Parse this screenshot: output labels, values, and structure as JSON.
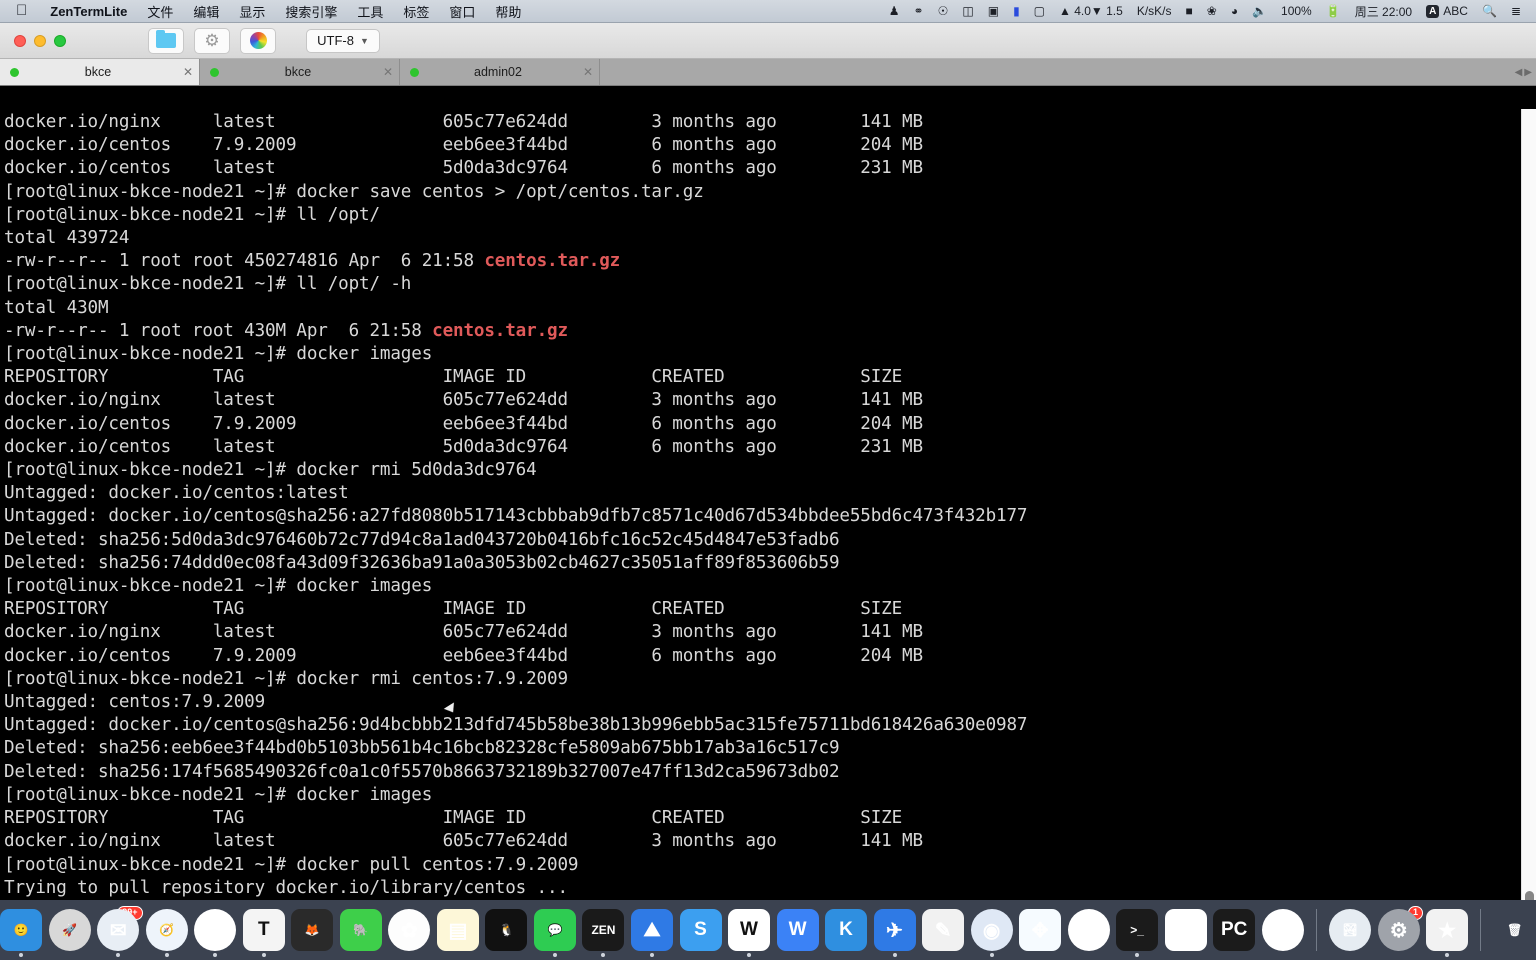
{
  "menubar": {
    "apple_icon": "apple-logo-icon",
    "app_name": "ZenTermLite",
    "items": [
      "文件",
      "编辑",
      "显示",
      "搜索引擎",
      "工具",
      "标签",
      "窗口",
      "帮助"
    ],
    "status": {
      "net_up": "▲ 4.0",
      "net_up_unit": "K/s",
      "net_down": "▼ 1.5",
      "net_down_unit": "K/s",
      "battery_percent": "100%",
      "clock": "周三 22:00",
      "input_badge": "A",
      "input_method": "ABC",
      "icons": [
        "bell-icon",
        "wechat-icon",
        "app-icon",
        "columns-icon",
        "screen-record-icon",
        "battery-bar-icon",
        "phone-icon",
        "network-speed-icon",
        "display-icon",
        "bluetooth-icon",
        "wifi-icon",
        "volume-icon",
        "battery-charging-icon",
        "search-icon",
        "control-center-icon"
      ]
    }
  },
  "titlebar": {
    "traffic_lights": [
      "close",
      "minimize",
      "zoom"
    ],
    "toolbar_buttons": [
      {
        "name": "folder-icon"
      },
      {
        "name": "gear-icon"
      },
      {
        "name": "color-wheel-icon"
      }
    ],
    "encoding": {
      "value": "UTF-8",
      "chevron": "chevron-down-icon"
    }
  },
  "tabs": [
    {
      "label": "bkce",
      "active": true,
      "status": "connected"
    },
    {
      "label": "bkce",
      "active": false,
      "status": "connected"
    },
    {
      "label": "admin02",
      "active": false,
      "status": "connected"
    }
  ],
  "terminal": {
    "prompt": "[root@linux-bkce-node21 ~]#",
    "lines": [
      {
        "t": "docker.io/nginx     latest                605c77e624dd        3 months ago        141 MB"
      },
      {
        "t": "docker.io/centos    7.9.2009              eeb6ee3f44bd        6 months ago        204 MB"
      },
      {
        "t": "docker.io/centos    latest                5d0da3dc9764        6 months ago        231 MB"
      },
      {
        "t": "[root@linux-bkce-node21 ~]# docker save centos > /opt/centos.tar.gz"
      },
      {
        "t": "[root@linux-bkce-node21 ~]# ll /opt/"
      },
      {
        "t": "total 439724"
      },
      {
        "t": "-rw-r--r-- 1 root root 450274816 Apr  6 21:58 ",
        "red": "centos.tar.gz"
      },
      {
        "t": "[root@linux-bkce-node21 ~]# ll /opt/ -h"
      },
      {
        "t": "total 430M"
      },
      {
        "t": "-rw-r--r-- 1 root root 430M Apr  6 21:58 ",
        "red": "centos.tar.gz"
      },
      {
        "t": "[root@linux-bkce-node21 ~]# docker images"
      },
      {
        "t": "REPOSITORY          TAG                   IMAGE ID            CREATED             SIZE"
      },
      {
        "t": "docker.io/nginx     latest                605c77e624dd        3 months ago        141 MB"
      },
      {
        "t": "docker.io/centos    7.9.2009              eeb6ee3f44bd        6 months ago        204 MB"
      },
      {
        "t": "docker.io/centos    latest                5d0da3dc9764        6 months ago        231 MB"
      },
      {
        "t": "[root@linux-bkce-node21 ~]# docker rmi 5d0da3dc9764"
      },
      {
        "t": "Untagged: docker.io/centos:latest"
      },
      {
        "t": "Untagged: docker.io/centos@sha256:a27fd8080b517143cbbbab9dfb7c8571c40d67d534bbdee55bd6c473f432b177"
      },
      {
        "t": "Deleted: sha256:5d0da3dc976460b72c77d94c8a1ad043720b0416bfc16c52c45d4847e53fadb6"
      },
      {
        "t": "Deleted: sha256:74ddd0ec08fa43d09f32636ba91a0a3053b02cb4627c35051aff89f853606b59"
      },
      {
        "t": "[root@linux-bkce-node21 ~]# docker images"
      },
      {
        "t": "REPOSITORY          TAG                   IMAGE ID            CREATED             SIZE"
      },
      {
        "t": "docker.io/nginx     latest                605c77e624dd        3 months ago        141 MB"
      },
      {
        "t": "docker.io/centos    7.9.2009              eeb6ee3f44bd        6 months ago        204 MB"
      },
      {
        "t": "[root@linux-bkce-node21 ~]# docker rmi centos:7.9.2009"
      },
      {
        "t": "Untagged: centos:7.9.2009"
      },
      {
        "t": "Untagged: docker.io/centos@sha256:9d4bcbbb213dfd745b58be38b13b996ebb5ac315fe75711bd618426a630e0987"
      },
      {
        "t": "Deleted: sha256:eeb6ee3f44bd0b5103bb561b4c16bcb82328cfe5809ab675bb17ab3a16c517c9"
      },
      {
        "t": "Deleted: sha256:174f5685490326fc0a1c0f5570b8663732189b327007e47ff13d2ca59673db02"
      },
      {
        "t": "[root@linux-bkce-node21 ~]# docker images"
      },
      {
        "t": "REPOSITORY          TAG                   IMAGE ID            CREATED             SIZE"
      },
      {
        "t": "docker.io/nginx     latest                605c77e624dd        3 months ago        141 MB"
      },
      {
        "t": "[root@linux-bkce-node21 ~]# docker pull centos:7.9.2009"
      },
      {
        "t": "Trying to pull repository docker.io/library/centos ..."
      }
    ],
    "cursor_visible": true,
    "colors": {
      "background": "#000000",
      "foreground": "#d8d8d8",
      "red": "#e05a5a",
      "cursor": "#2ee02e"
    }
  },
  "dock": {
    "items": [
      {
        "name": "finder-icon",
        "glyph": "🙂",
        "bg": "#2f8fe0",
        "running": true
      },
      {
        "name": "launchpad-icon",
        "glyph": "🚀",
        "bg": "#d8d8d8",
        "running": false
      },
      {
        "name": "foxmail-icon",
        "glyph": "✉",
        "bg": "#e8eef5",
        "running": true,
        "badge": "99+"
      },
      {
        "name": "safari-icon",
        "glyph": "🧭",
        "bg": "#eef4fb",
        "running": true
      },
      {
        "name": "chrome-icon",
        "glyph": "◎",
        "bg": "#ffffff",
        "running": true
      },
      {
        "name": "typora-icon",
        "glyph": "T",
        "bg": "#f4f4f4",
        "running": true
      },
      {
        "name": "firefox-icon",
        "glyph": "🦊",
        "bg": "#2a2a2a",
        "running": false
      },
      {
        "name": "evernote-icon",
        "glyph": "🐘",
        "bg": "#3ecf4a",
        "running": false
      },
      {
        "name": "photos-icon",
        "glyph": "✿",
        "bg": "#fdfdfd",
        "running": false
      },
      {
        "name": "notes-icon",
        "glyph": "▤",
        "bg": "#fdf7d8",
        "running": false
      },
      {
        "name": "qq-icon",
        "glyph": "🐧",
        "bg": "#111111",
        "running": false
      },
      {
        "name": "wechat-icon",
        "glyph": "💬",
        "bg": "#2ecc52",
        "running": true
      },
      {
        "name": "zentermlite-icon",
        "glyph": "ZEN",
        "bg": "#1a1a1a",
        "running": true
      },
      {
        "name": "mountain-app-icon",
        "glyph": "⛰",
        "bg": "#2f7ae5",
        "running": true
      },
      {
        "name": "shanchuan-icon",
        "glyph": "S",
        "bg": "#3c9ff0",
        "running": false
      },
      {
        "name": "wps-icon",
        "glyph": "W",
        "bg": "#ffffff",
        "running": true
      },
      {
        "name": "wiz-icon",
        "glyph": "W",
        "bg": "#3b82f6",
        "running": false
      },
      {
        "name": "keka-icon",
        "glyph": "K",
        "bg": "#2f8fe0",
        "running": false
      },
      {
        "name": "tim-icon",
        "glyph": "✈",
        "bg": "#2f7ae5",
        "running": true
      },
      {
        "name": "calendar-note-icon",
        "glyph": "✎",
        "bg": "#f1f1f1",
        "running": false
      },
      {
        "name": "baidu-netdisk-icon",
        "glyph": "◉",
        "bg": "#dfe8f5",
        "running": true
      },
      {
        "name": "xmind-icon",
        "glyph": "✥",
        "bg": "#f6fbff",
        "running": false
      },
      {
        "name": "iqiyi-icon",
        "glyph": "▶",
        "bg": "#ffffff",
        "running": false
      },
      {
        "name": "iterm-icon",
        "glyph": ">_",
        "bg": "#1b1b1b",
        "running": true
      },
      {
        "name": "vscode-icon",
        "glyph": "✂",
        "bg": "#ffffff",
        "running": false
      },
      {
        "name": "pycharm-icon",
        "glyph": "PC",
        "bg": "#1b1b1b",
        "running": false
      },
      {
        "name": "qq-browser-icon",
        "glyph": "◐",
        "bg": "#ffffff",
        "running": false
      }
    ],
    "recent_items": [
      {
        "name": "preview-icon",
        "glyph": "🏞",
        "bg": "#e6ecf2",
        "running": false
      },
      {
        "name": "system-preferences-icon",
        "glyph": "⚙",
        "bg": "#9fa3aa",
        "running": false,
        "badge": "1"
      },
      {
        "name": "imovie-icon",
        "glyph": "★",
        "bg": "#f2f2f2",
        "running": true
      }
    ],
    "trash": {
      "name": "trash-icon",
      "glyph": "🗑"
    }
  }
}
